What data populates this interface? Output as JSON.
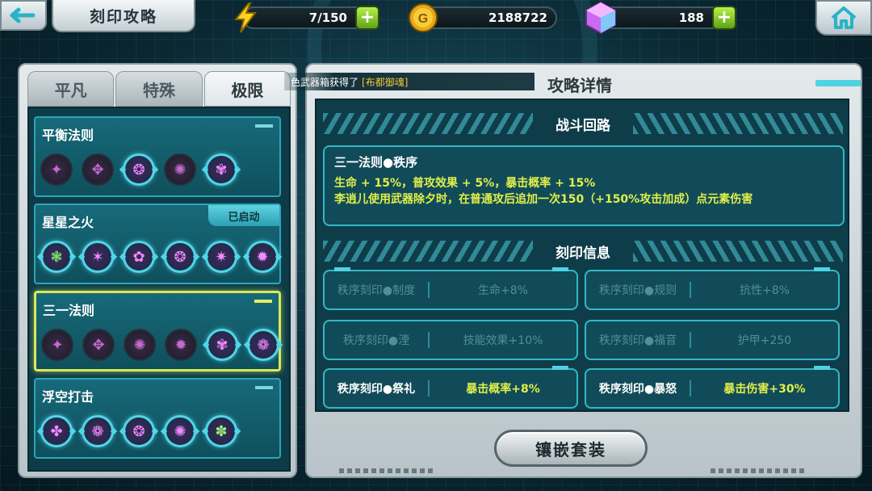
{
  "header": {
    "title": "刻印攻略",
    "energy": "7/150",
    "gold": "2188722",
    "crystals": "188"
  },
  "notice": {
    "text": "色武器箱获得了",
    "highlight": "[布都御魂]"
  },
  "tabs": [
    {
      "label": "平凡",
      "active": false
    },
    {
      "label": "特殊",
      "active": false
    },
    {
      "label": "极限",
      "active": true
    }
  ],
  "strategies": [
    {
      "name": "平衡法则",
      "badge": "",
      "selected": false
    },
    {
      "name": "星星之火",
      "badge": "已启动",
      "selected": false
    },
    {
      "name": "三一法则",
      "badge": "",
      "selected": true
    },
    {
      "name": "浮空打击",
      "badge": "",
      "selected": false
    }
  ],
  "detail": {
    "title": "攻略详情",
    "battle_section": "战斗回路",
    "effect_name": "三一法则●秩序",
    "effect_line1": "生命 + 15%，普攻效果 + 5%，暴击概率 + 15%",
    "effect_line2": "李逍儿使用武器除夕时，在普通攻后追加一次150（+150%攻击加成）点元素伤害",
    "engrave_section": "刻印信息",
    "engravings": [
      {
        "name": "秩序刻印●制度",
        "value": "生命+8%",
        "lit": false
      },
      {
        "name": "秩序刻印●规则",
        "value": "抗性+8%",
        "lit": false
      },
      {
        "name": "秩序刻印●湮",
        "value": "技能效果+10%",
        "lit": false
      },
      {
        "name": "秩序刻印●福音",
        "value": "护甲+250",
        "lit": false
      },
      {
        "name": "秩序刻印●祭礼",
        "value": "暴击概率+8%",
        "lit": true
      },
      {
        "name": "秩序刻印●暴怒",
        "value": "暴击伤害+30%",
        "lit": true
      }
    ]
  },
  "actions": {
    "equip_label": "镶嵌套装"
  },
  "colors": {
    "accent_cyan": "#4fd2e2",
    "highlight_yellow": "#e0ef4a",
    "selected_border": "#d8e85a"
  }
}
